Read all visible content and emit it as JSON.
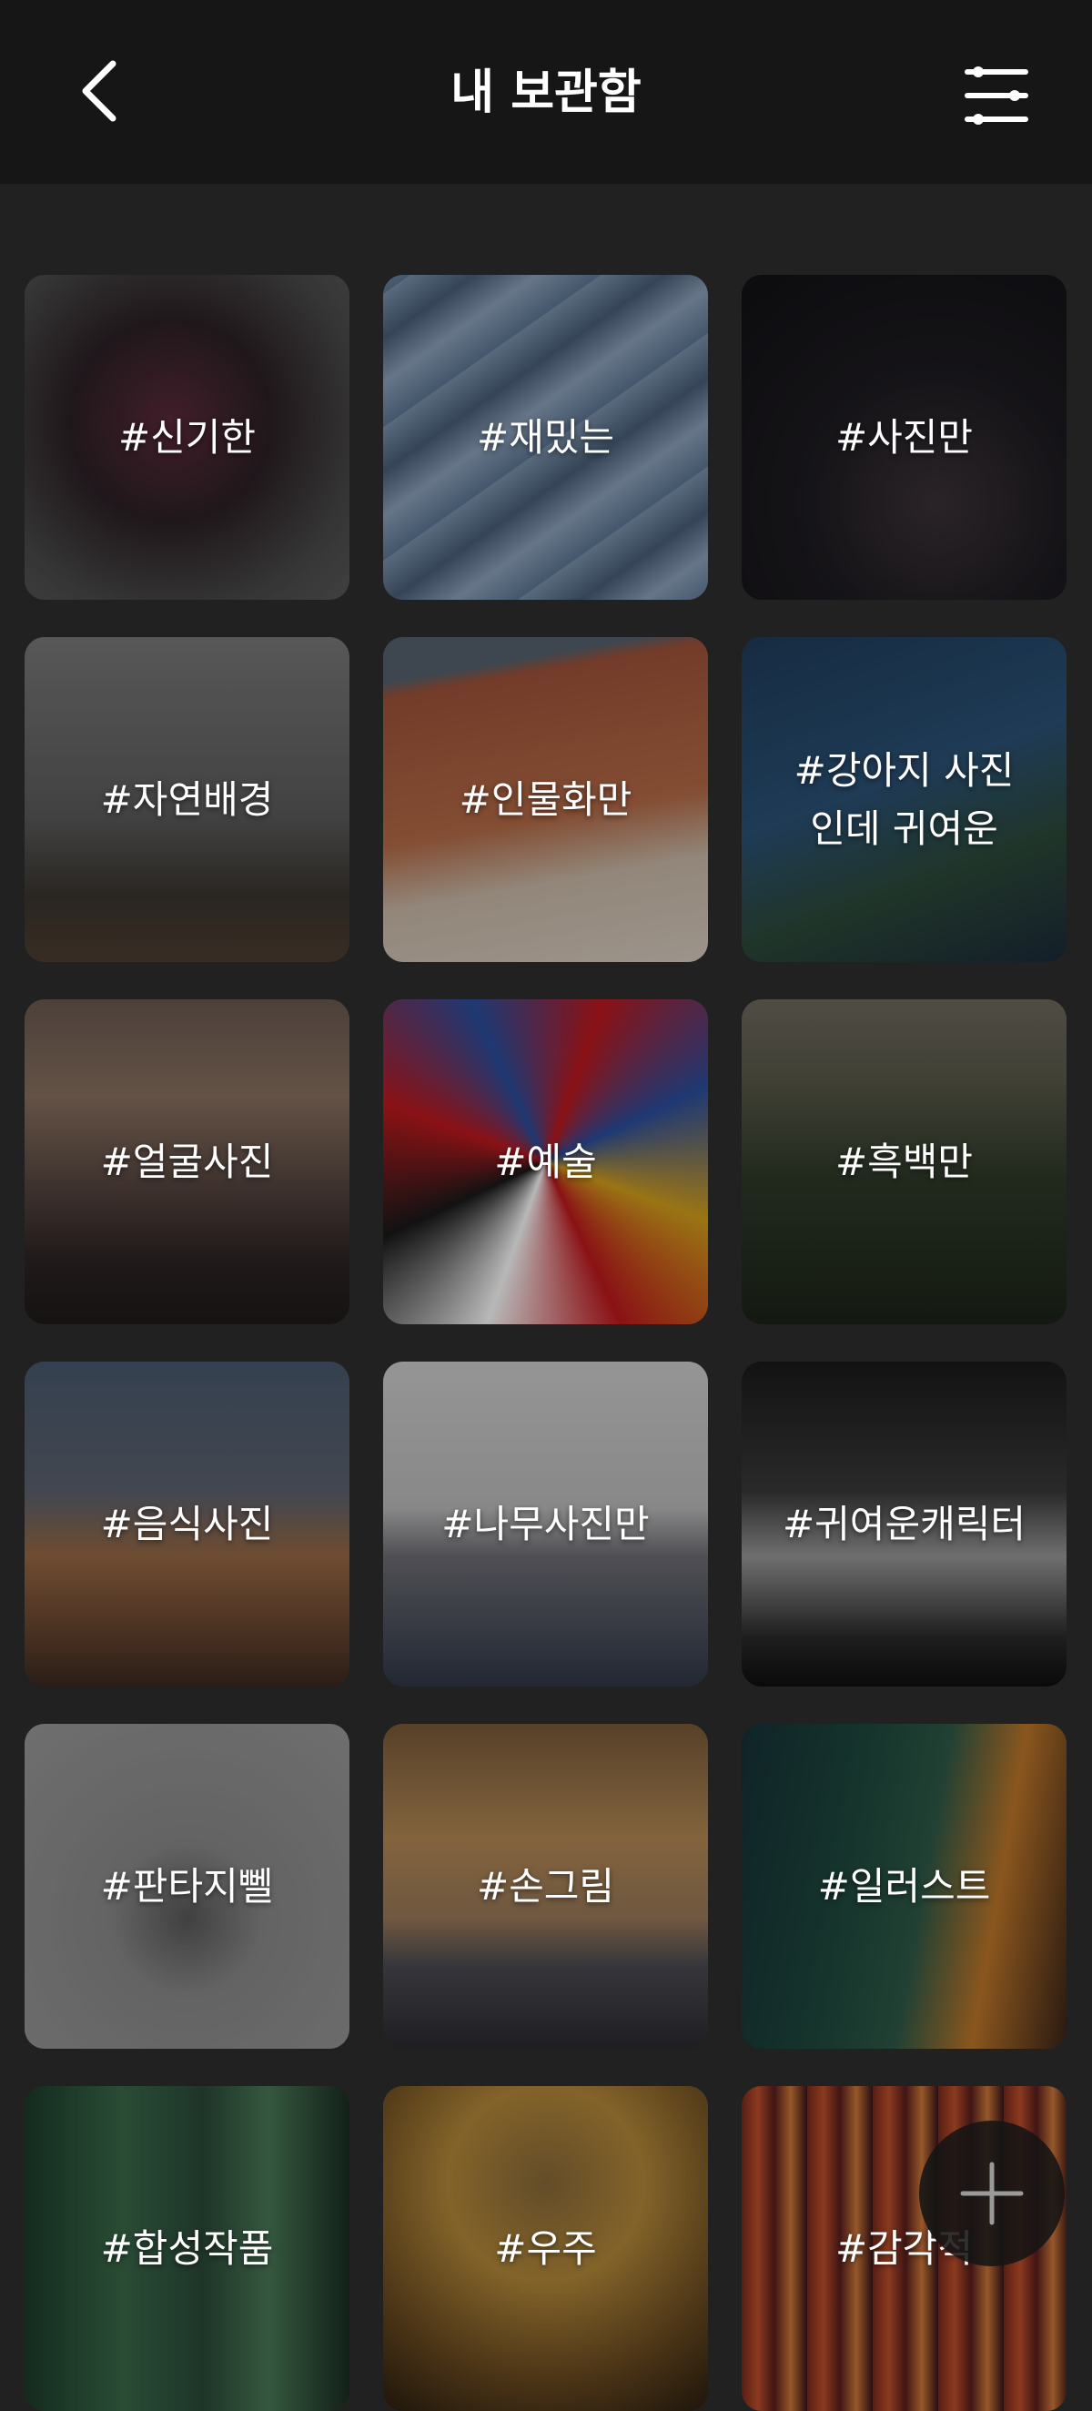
{
  "header": {
    "title": "내 보관함",
    "back_icon": "chevron-left-icon",
    "filter_icon": "sliders-icon"
  },
  "tiles": [
    {
      "label": "#신기한",
      "bg": "radial-gradient(circle at 45% 45%, #5b2a3a 0%, #2c2126 40%, #4a4a4a 75%, #5a5a5a 100%)"
    },
    {
      "label": "#재밌는",
      "bg": "repeating-linear-gradient(-35deg, #5f7896 0px, #8ea4bd 40px, #4a6079 80px, #7b93ad 120px)"
    },
    {
      "label": "#사진만",
      "bg": "radial-gradient(circle at 60% 70%, #3b3237 0%, #1d1b20 45%, #111014 100%)"
    },
    {
      "label": "#자연배경",
      "bg": "linear-gradient(180deg, #7a7a7a 0%, #5c5c5c 55%, #3a3530 80%, #4e3f31 100%)"
    },
    {
      "label": "#인물화만",
      "bg": "linear-gradient(170deg, #56636e 0%, #56636e 12%, #a0533a 16%, #b66c48 55%, #cbbba9 72%, #d9cdc1 100%)"
    },
    {
      "label": "#강아지 사진\n인데 귀여운",
      "bg": "linear-gradient(160deg, #1f3d5c 0%, #2b5277 45%, #2d4a3a 70%, #1b2b3a 100%)"
    },
    {
      "label": "#얼굴사진",
      "bg": "linear-gradient(180deg, #6b5a52 0%, #8a7260 30%, #5c4a44 55%, #2e2424 80%, #1f1a1a 100%)"
    },
    {
      "label": "#예술",
      "bg": "conic-gradient(from 20deg at 50% 50%, #c0191e, #2b4fa0, #d6a21c, #c0191e, #ffffff, #1a1a1a, #c0191e, #2b4fa0, #c0191e)"
    },
    {
      "label": "#흑백만",
      "bg": "linear-gradient(180deg, #6f6a5f 0%, #5a5a4a 25%, #2f3a2a 55%, #1c2418 100%)"
    },
    {
      "label": "#음식사진",
      "bg": "linear-gradient(180deg, #4a5a70 0%, #5c6370 40%, #9a6a45 60%, #6e4a32 80%, #3a2a20 100%)"
    },
    {
      "label": "#나무사진만",
      "bg": "linear-gradient(180deg, #cfcfcf 0%, #bdbdbd 45%, #6e6e75 60%, #303848 100%)"
    },
    {
      "label": "#귀여운캐릭터",
      "bg": "linear-gradient(180deg, #1a1a1a 0%, #3a3a3a 40%, #9a9a9a 60%, #2a2a2a 85%, #0e0e0e 100%)"
    },
    {
      "label": "#판타지뻴",
      "bg": "radial-gradient(circle at 50% 60%, #5a5a5a 0%, #8a8a8a 30%, #9a9a9a 100%)"
    },
    {
      "label": "#손그림",
      "bg": "linear-gradient(180deg, #7a5a3a 0%, #b58a55 35%, #9a7a5a 60%, #4a4a52 75%, #2a2a30 100%)"
    },
    {
      "label": "#일러스트",
      "bg": "linear-gradient(100deg, #163238 0%, #1f4a3e 35%, #2e5a48 55%, #c0782a 75%, #3a2418 100%)"
    },
    {
      "label": "#합성작품",
      "bg": "linear-gradient(90deg, #1c3b2a 0%, #3a6a4a 30%, #2a4a38 55%, #4a7a58 75%, #1a2e22 100%)"
    },
    {
      "label": "#우주",
      "bg": "radial-gradient(circle at 50% 30%, #8a6a3a 0%, #b58a3a 35%, #6a4a20 70%, #2a1e10 100%)"
    },
    {
      "label": "#감각적",
      "bg": "repeating-linear-gradient(90deg, #7a2a1e 0px, #c0512a 18px, #5a1e1e 36px, #d07a3a 54px, #3a1418 72px)"
    }
  ],
  "fab": {
    "icon": "plus-icon"
  }
}
